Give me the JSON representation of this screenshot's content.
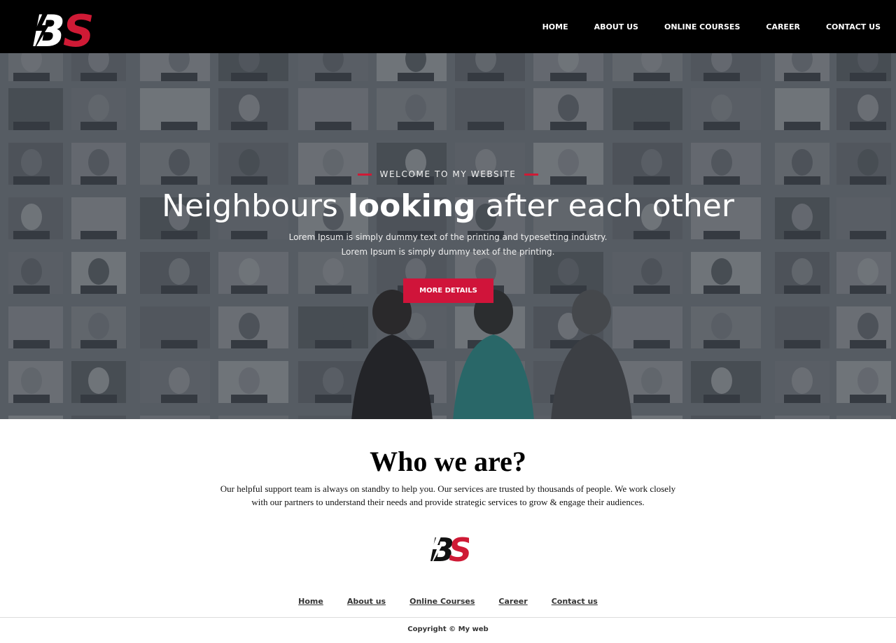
{
  "brand": {
    "logo_text_b": "B",
    "logo_text_s": "S",
    "accent_color": "#cf1a35"
  },
  "nav": {
    "items": [
      {
        "label": "HOME"
      },
      {
        "label": "ABOUT US"
      },
      {
        "label": "ONLINE COURSES"
      },
      {
        "label": "CAREER"
      },
      {
        "label": "CONTACT US"
      }
    ]
  },
  "hero": {
    "eyebrow": "WELCOME TO MY WEBSITE",
    "headline_part1": "Neighbours ",
    "headline_bold": "looking",
    "headline_part2": " after each other",
    "subtext_line1": "Lorem Ipsum is simply dummy text of the printing and typesetting industry.",
    "subtext_line2": "Lorem Ipsum is simply dummy text of the printing.",
    "cta_label": "MORE DETAILS"
  },
  "about": {
    "title": "Who we are?",
    "text": "Our helpful support team is always on standby to help you. Our services are trusted by thousands of people. We work closely with our partners to understand their needs and provide strategic services to grow & engage their audiences."
  },
  "footer": {
    "links": [
      {
        "label": "Home"
      },
      {
        "label": "About us"
      },
      {
        "label": "Online Courses"
      },
      {
        "label": "Career"
      },
      {
        "label": "Contact us"
      }
    ],
    "copyright": "Copyright © My web"
  }
}
